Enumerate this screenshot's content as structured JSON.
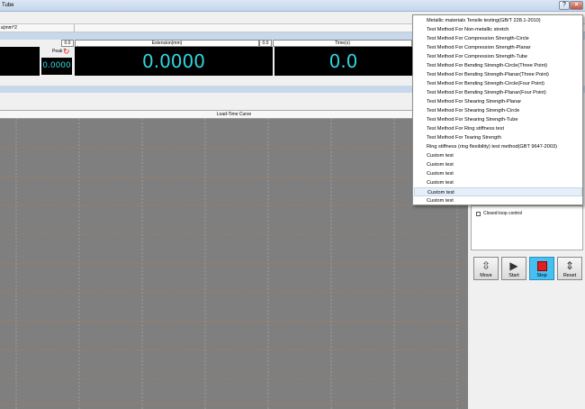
{
  "window": {
    "title": "Tube",
    "close_glyph": "×",
    "help_glyph": "?"
  },
  "units": {
    "label": "a(mm^2"
  },
  "panels": {
    "small_val_1": "0.0",
    "extension_label": "Extension(mm)",
    "small_val_2": "0.0",
    "time_label": "Time(s)",
    "peak_label": "Peak",
    "peak_value": "0.0000",
    "extension_value": "0.0000",
    "time_value": "0.0"
  },
  "chart": {
    "title": "Load-Time Curve"
  },
  "menu": {
    "items": [
      "Metallic materials Tensile testing(GB/T 228.1-2010)",
      "Test Method For Non-metallic stretch",
      "Test Method For Compression Strength-Circle",
      "Test Method For Compression Strength-Planar",
      "Test Method For Compression Strength-Tube",
      "Test Method For Bending Strength-Circle(Three Point)",
      "Test Method For Bending Strength-Planar(Three Point)",
      "Test Method For Bending Strength-Circle(Four Point)",
      "Test Method For Bending Strength-Planar(Four Point)",
      "Test Method For Shearing Strength-Planar",
      "Test Method For Shearing Strength-Circle",
      "Test Method For Shearing Strength-Tube",
      "Test Method For Ring stiffness test",
      "Test Method For Tearing Strength",
      "Ring stiffness (ring flexibility) test method(GBT 9647-2003)",
      "Custom test",
      "Custom test",
      "Custom test",
      "Custom test",
      "Custom test",
      "Custom test"
    ],
    "highlighted_index": 19
  },
  "control": {
    "closed_loop_label": "Closed-loop control"
  },
  "buttons": {
    "move": "Move",
    "start": "Start",
    "stop": "Stop",
    "reset": "Reset"
  },
  "colors": {
    "display_text": "#2fd6e0",
    "chart_bg": "#7f7f7f",
    "stop_active": "#46c0f3"
  }
}
